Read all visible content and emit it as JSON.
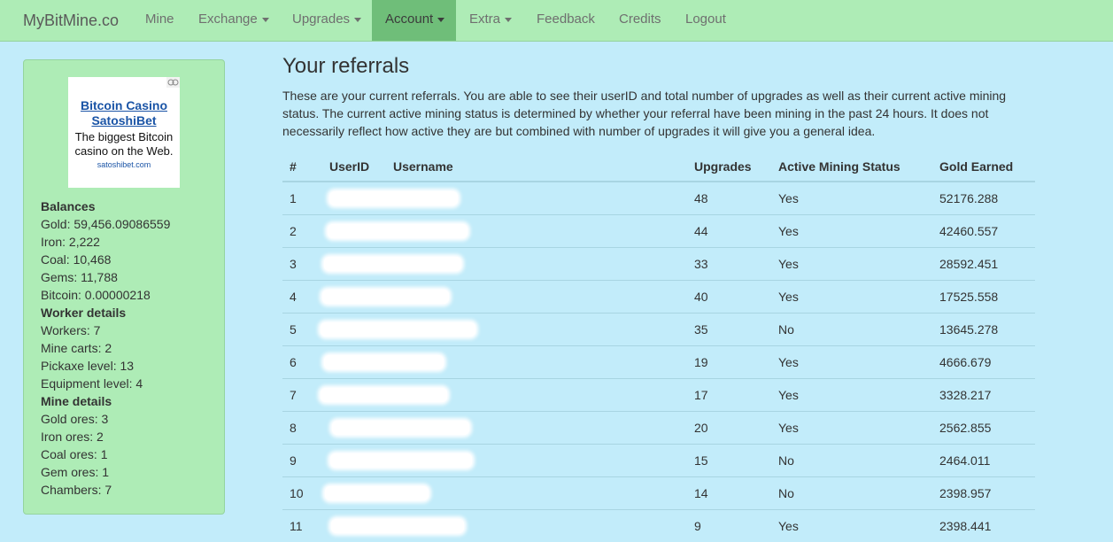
{
  "navbar": {
    "brand": "MyBitMine.co",
    "items": [
      {
        "label": "Mine",
        "caret": false,
        "active": false
      },
      {
        "label": "Exchange",
        "caret": true,
        "active": false
      },
      {
        "label": "Upgrades",
        "caret": true,
        "active": false
      },
      {
        "label": "Account",
        "caret": true,
        "active": true
      },
      {
        "label": "Extra",
        "caret": true,
        "active": false
      },
      {
        "label": "Feedback",
        "caret": false,
        "active": false
      },
      {
        "label": "Credits",
        "caret": false,
        "active": false
      },
      {
        "label": "Logout",
        "caret": false,
        "active": false
      }
    ]
  },
  "ad": {
    "title_line1": "Bitcoin Casino",
    "title_line2": "SatoshiBet",
    "body_line1": "The biggest Bitcoin",
    "body_line2": "casino on the Web.",
    "url": "satoshibet.com"
  },
  "sidebar": {
    "balances_heading": "Balances",
    "balances": [
      "Gold: 59,456.09086559",
      "Iron: 2,222",
      "Coal: 10,468",
      "Gems: 11,788",
      "Bitcoin: 0.00000218"
    ],
    "worker_heading": "Worker details",
    "worker": [
      "Workers: 7",
      "Mine carts: 2",
      "Pickaxe level: 13",
      "Equipment level: 4"
    ],
    "mine_heading": "Mine details",
    "mine": [
      "Gold ores: 3",
      "Iron ores: 2",
      "Coal ores: 1",
      "Gem ores: 1",
      "Chambers: 7"
    ]
  },
  "main": {
    "title": "Your referrals",
    "intro": "These are your current referrals. You are able to see their userID and total number of upgrades as well as their current active mining status. The current active mining status is determined by whether your referral have been mining in the past 24 hours. It does not necessarily reflect how active they are but combined with number of upgrades it will give you a general idea."
  },
  "table": {
    "headers": [
      "#",
      "UserID",
      "Username",
      "Upgrades",
      "Active Mining Status",
      "Gold Earned"
    ],
    "rows": [
      {
        "num": "1",
        "upgrades": "48",
        "status": "Yes",
        "gold": "52176.288"
      },
      {
        "num": "2",
        "upgrades": "44",
        "status": "Yes",
        "gold": "42460.557"
      },
      {
        "num": "3",
        "upgrades": "33",
        "status": "Yes",
        "gold": "28592.451"
      },
      {
        "num": "4",
        "upgrades": "40",
        "status": "Yes",
        "gold": "17525.558"
      },
      {
        "num": "5",
        "upgrades": "35",
        "status": "No",
        "gold": "13645.278"
      },
      {
        "num": "6",
        "upgrades": "19",
        "status": "Yes",
        "gold": "4666.679"
      },
      {
        "num": "7",
        "upgrades": "17",
        "status": "Yes",
        "gold": "3328.217"
      },
      {
        "num": "8",
        "upgrades": "20",
        "status": "Yes",
        "gold": "2562.855"
      },
      {
        "num": "9",
        "upgrades": "15",
        "status": "No",
        "gold": "2464.011"
      },
      {
        "num": "10",
        "upgrades": "14",
        "status": "No",
        "gold": "2398.957"
      },
      {
        "num": "11",
        "upgrades": "9",
        "status": "Yes",
        "gold": "2398.441"
      }
    ]
  }
}
